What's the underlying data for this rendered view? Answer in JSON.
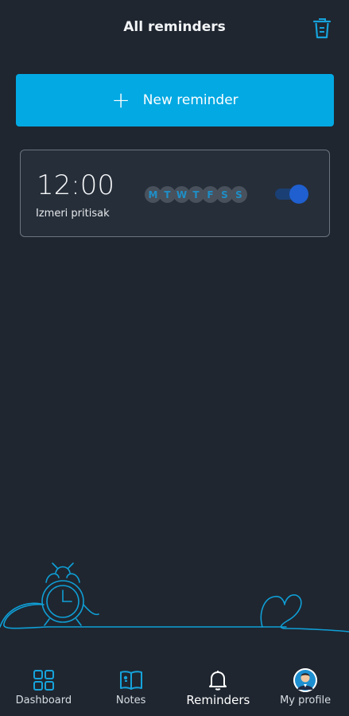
{
  "header": {
    "title": "All reminders",
    "trash_icon": "trash-icon"
  },
  "new_reminder": {
    "label": "New reminder",
    "icon": "plus-icon"
  },
  "reminders": [
    {
      "time": "12:00",
      "name": "Izmeri pritisak",
      "days": [
        "M",
        "T",
        "W",
        "T",
        "F",
        "S",
        "S"
      ],
      "enabled": true
    }
  ],
  "bottom_nav": {
    "items": [
      {
        "label": "Dashboard",
        "icon": "dashboard-grid-icon",
        "active": false
      },
      {
        "label": "Notes",
        "icon": "book-icon",
        "active": false
      },
      {
        "label": "Reminders",
        "icon": "bell-icon",
        "active": true
      },
      {
        "label": "My profile",
        "icon": "avatar-icon",
        "active": false
      }
    ]
  },
  "colors": {
    "background": "#1f2630",
    "accent": "#02a9e3",
    "card": "#262e39",
    "day_text": "#1e8fc8",
    "toggle_knob": "#1f5fcf"
  }
}
